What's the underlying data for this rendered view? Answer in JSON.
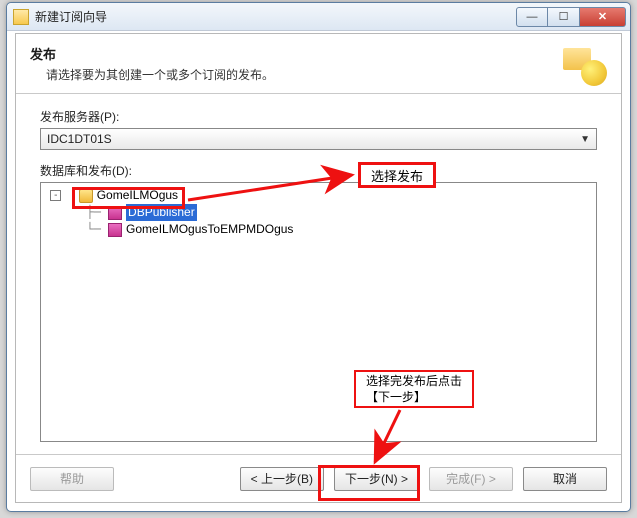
{
  "window": {
    "title": "新建订阅向导"
  },
  "header": {
    "title": "发布",
    "subtitle": "请选择要为其创建一个或多个订阅的发布。"
  },
  "publisher": {
    "label": "发布服务器(P):",
    "value": "IDC1DT01S"
  },
  "tree": {
    "label": "数据库和发布(D):",
    "root": "GomeILMOgus",
    "items": [
      {
        "name": "DBPublisher",
        "selected": true
      },
      {
        "name": "GomeILMOgusToEMPMDOgus",
        "selected": false
      }
    ]
  },
  "buttons": {
    "help": "帮助",
    "back": "< 上一步(B)",
    "next": "下一步(N) >",
    "finish": "完成(F) >",
    "cancel": "取消"
  },
  "annotations": {
    "a1": "选择发布",
    "a2": "选择完发布后点击\n【下一步】"
  }
}
